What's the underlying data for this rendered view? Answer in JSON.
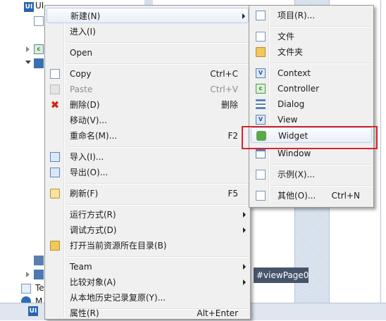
{
  "background": {
    "tree_root_label": "UI",
    "dark_field_text": "#viewPage0",
    "tree_te_label": "Te",
    "tree_m_label": "M",
    "status_icon_text": "UI"
  },
  "main_menu": {
    "items": [
      {
        "label": "新建(N)",
        "shortcut": "",
        "submenu": true
      },
      {
        "label": "进入(I)",
        "shortcut": ""
      },
      {
        "label": "Open",
        "shortcut": ""
      },
      {
        "label": "Copy",
        "shortcut": "Ctrl+C"
      },
      {
        "label": "Paste",
        "shortcut": "Ctrl+V",
        "disabled": true
      },
      {
        "label": "删除(D)",
        "shortcut": "删除"
      },
      {
        "label": "移动(V)...",
        "shortcut": ""
      },
      {
        "label": "重命名(M)...",
        "shortcut": "F2"
      },
      {
        "label": "导入(I)...",
        "shortcut": ""
      },
      {
        "label": "导出(O)...",
        "shortcut": ""
      },
      {
        "label": "刷新(F)",
        "shortcut": "F5"
      },
      {
        "label": "运行方式(R)",
        "shortcut": "",
        "submenu": true
      },
      {
        "label": "调试方式(D)",
        "shortcut": "",
        "submenu": true
      },
      {
        "label": "打开当前资源所在目录(B)",
        "shortcut": ""
      },
      {
        "label": "Team",
        "shortcut": "",
        "submenu": true
      },
      {
        "label": "比较对象(A)",
        "shortcut": "",
        "submenu": true
      },
      {
        "label": "从本地历史记录复原(Y)...",
        "shortcut": ""
      },
      {
        "label": "属性(R)",
        "shortcut": "Alt+Enter"
      }
    ]
  },
  "sub_menu": {
    "items": [
      {
        "label": "项目(R)...",
        "shortcut": ""
      },
      {
        "label": "文件",
        "shortcut": ""
      },
      {
        "label": "文件夹",
        "shortcut": ""
      },
      {
        "label": "Context",
        "shortcut": ""
      },
      {
        "label": "Controller",
        "shortcut": ""
      },
      {
        "label": "Dialog",
        "shortcut": ""
      },
      {
        "label": "View",
        "shortcut": ""
      },
      {
        "label": "Widget",
        "shortcut": ""
      },
      {
        "label": "Window",
        "shortcut": ""
      },
      {
        "label": "示例(X)...",
        "shortcut": ""
      },
      {
        "label": "其他(O)...",
        "shortcut": "Ctrl+N"
      }
    ]
  },
  "colors": {
    "menu_bg": "#f0f0f0",
    "highlight_border": "#d8242c",
    "hover_bg": "#e9eff8"
  }
}
